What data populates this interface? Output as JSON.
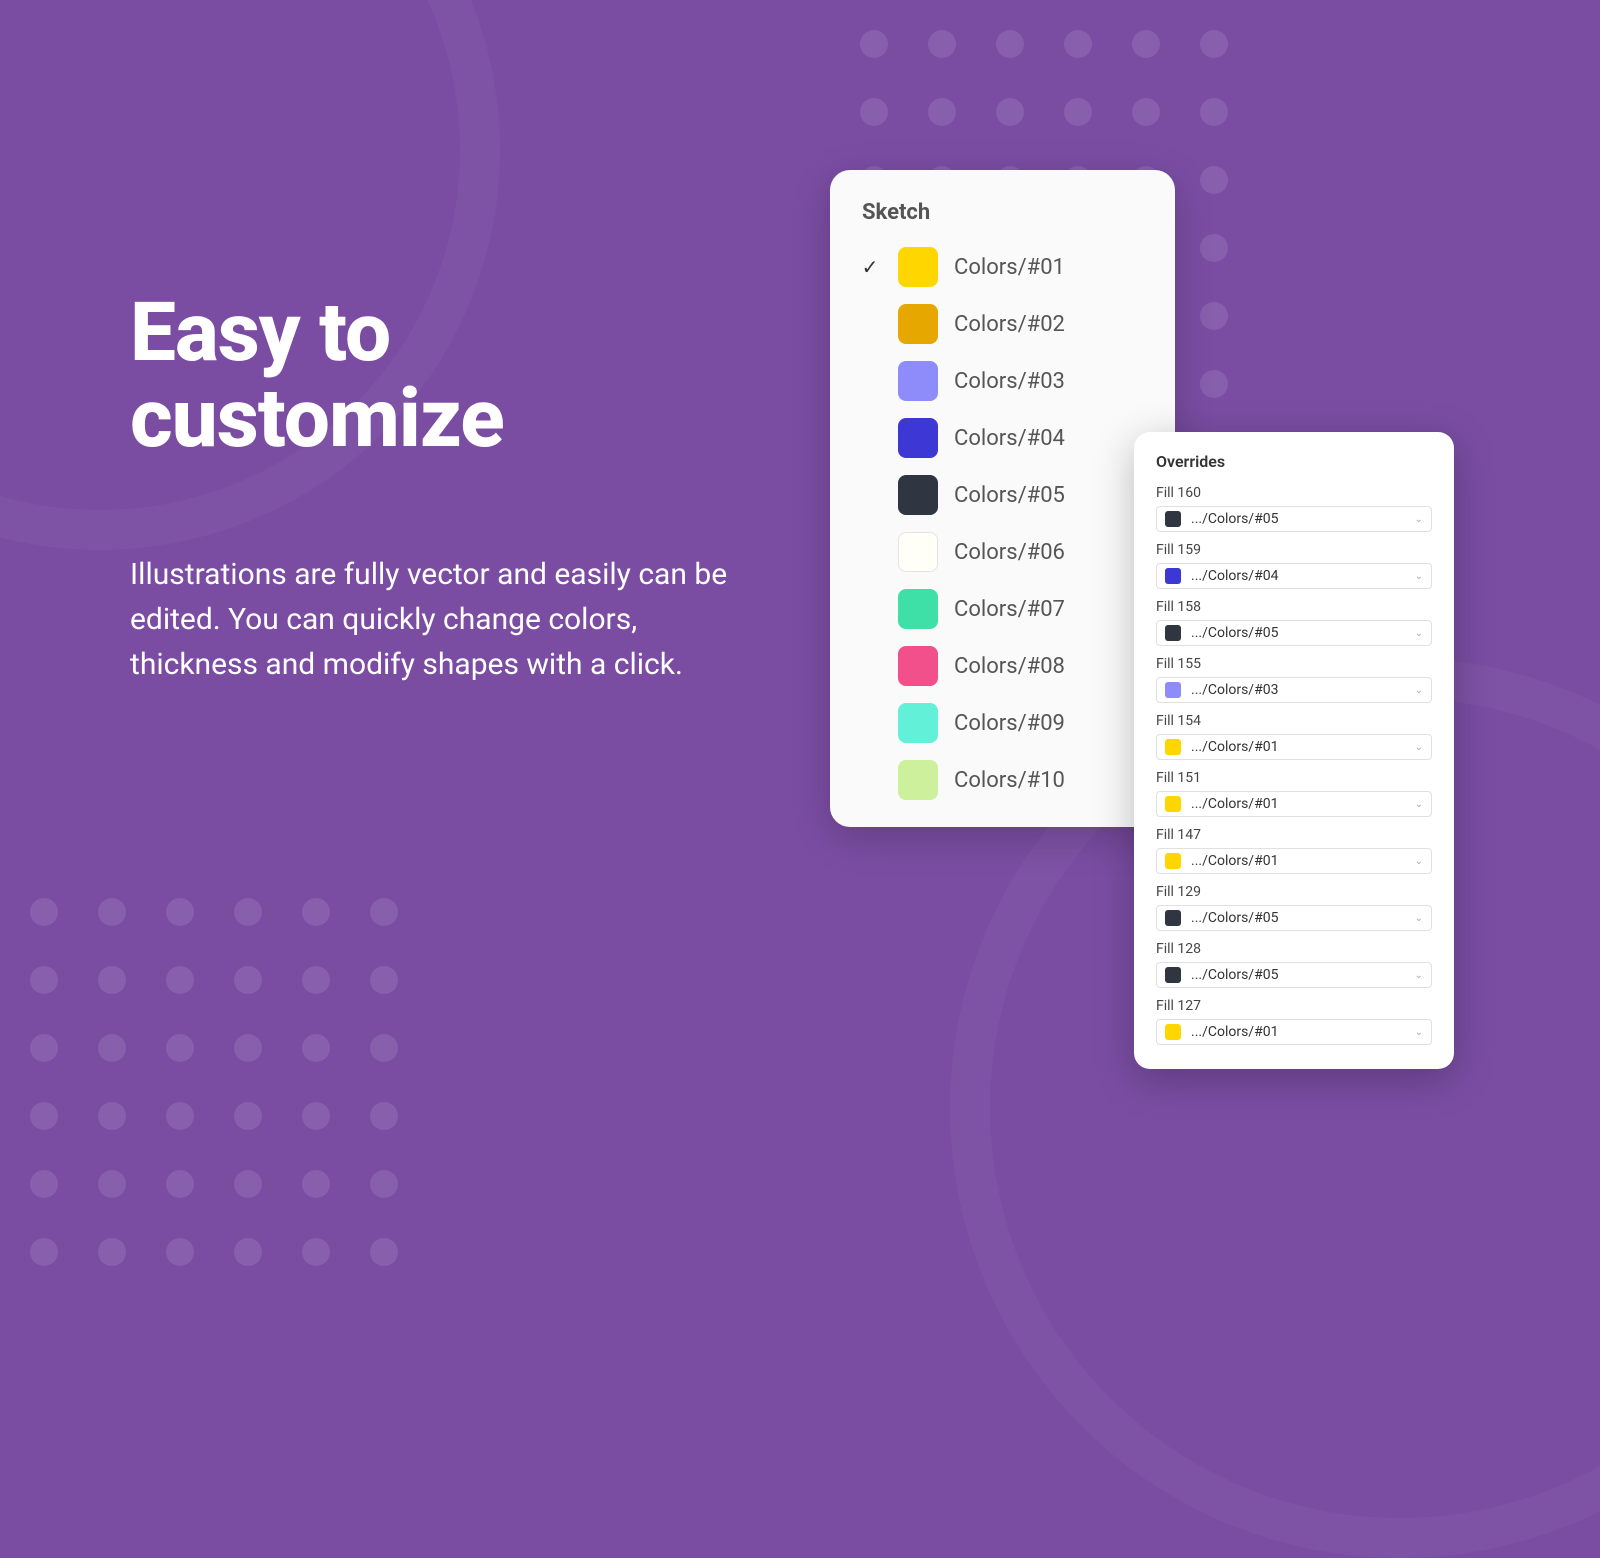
{
  "hero": {
    "title": "Easy to customize",
    "description": "Illustrations are fully vector and easily can be edited. You can quickly change colors, thickness and modify shapes with a click."
  },
  "sketch": {
    "title": "Sketch",
    "items": [
      {
        "selected": true,
        "label": "Colors/#01",
        "color": "#FFD600"
      },
      {
        "selected": false,
        "label": "Colors/#02",
        "color": "#E6A700"
      },
      {
        "selected": false,
        "label": "Colors/#03",
        "color": "#8E8CFA"
      },
      {
        "selected": false,
        "label": "Colors/#04",
        "color": "#3D37D6"
      },
      {
        "selected": false,
        "label": "Colors/#05",
        "color": "#303542"
      },
      {
        "selected": false,
        "label": "Colors/#06",
        "color": "#FFFFF7",
        "border": true
      },
      {
        "selected": false,
        "label": "Colors/#07",
        "color": "#3EE0A8"
      },
      {
        "selected": false,
        "label": "Colors/#08",
        "color": "#F2508B"
      },
      {
        "selected": false,
        "label": "Colors/#09",
        "color": "#62F0D9"
      },
      {
        "selected": false,
        "label": "Colors/#10",
        "color": "#CCF09B"
      }
    ]
  },
  "overrides": {
    "title": "Overrides",
    "items": [
      {
        "fill": "Fill 160",
        "value": ".../Colors/#05",
        "color": "#303542"
      },
      {
        "fill": "Fill 159",
        "value": ".../Colors/#04",
        "color": "#3D37D6"
      },
      {
        "fill": "Fill 158",
        "value": ".../Colors/#05",
        "color": "#303542"
      },
      {
        "fill": "Fill 155",
        "value": ".../Colors/#03",
        "color": "#8E8CFA"
      },
      {
        "fill": "Fill 154",
        "value": ".../Colors/#01",
        "color": "#FFD600"
      },
      {
        "fill": "Fill 151",
        "value": ".../Colors/#01",
        "color": "#FFD600"
      },
      {
        "fill": "Fill 147",
        "value": ".../Colors/#01",
        "color": "#FFD600"
      },
      {
        "fill": "Fill 129",
        "value": ".../Colors/#05",
        "color": "#303542"
      },
      {
        "fill": "Fill 128",
        "value": ".../Colors/#05",
        "color": "#303542"
      },
      {
        "fill": "Fill 127",
        "value": ".../Colors/#01",
        "color": "#FFD600"
      }
    ]
  }
}
